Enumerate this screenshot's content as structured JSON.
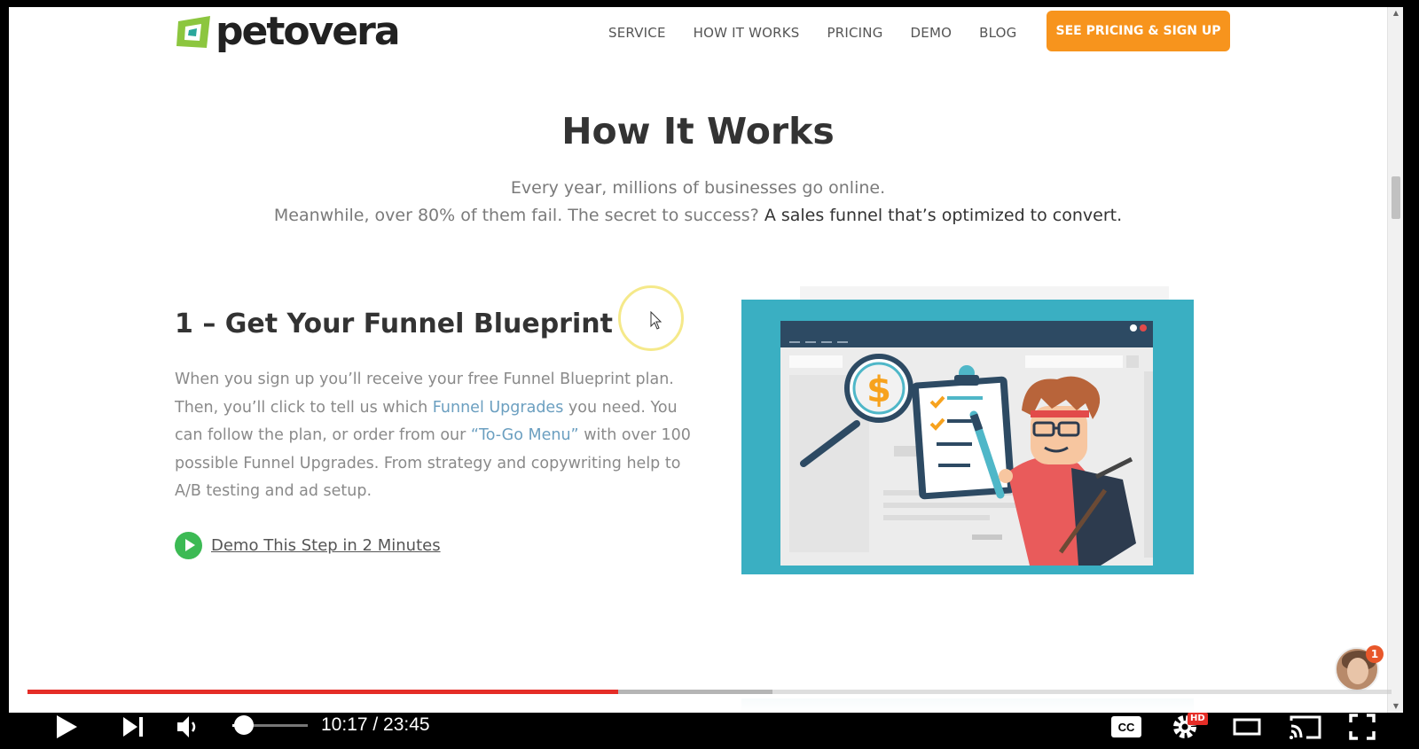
{
  "nav": {
    "logo_text": "petovera",
    "links": [
      "SERVICE",
      "HOW IT WORKS",
      "PRICING",
      "DEMO",
      "BLOG"
    ],
    "cta": "SEE PRICING & SIGN UP"
  },
  "hero": {
    "title": "How It Works",
    "line1": "Every year, millions of businesses go online.",
    "line2_plain": "Meanwhile, over 80% of them fail. The secret to success? ",
    "line2_em": "A sales funnel that’s optimized to convert."
  },
  "step1": {
    "title": "1 – Get Your Funnel Blueprint",
    "body_a": "When you sign up you’ll receive your free Funnel Blueprint plan. Then, you’ll click to tell us which ",
    "link1": "Funnel Upgrades",
    "body_b": " you need. You can follow the plan, or order from our ",
    "link2": "“To-Go Menu”",
    "body_c": " with over 100 possible Funnel Upgrades. From strategy and copywriting help to A/B testing and ad setup.",
    "demo_link": "Demo This Step in 2 Minutes"
  },
  "illustration": {
    "currency_symbol": "$"
  },
  "chat": {
    "badge_count": "1"
  },
  "player": {
    "time": "10:17 / 23:45",
    "progress_fraction": 0.433,
    "buffered_fraction": 0.546,
    "volume_fraction": 0.15,
    "hd_label": "HD",
    "cc_label": "CC",
    "accent_color": "#e52d27"
  },
  "colors": {
    "cta": "#f7941d",
    "link": "#6b9fc0",
    "illustration_bg": "#3aafc2"
  }
}
